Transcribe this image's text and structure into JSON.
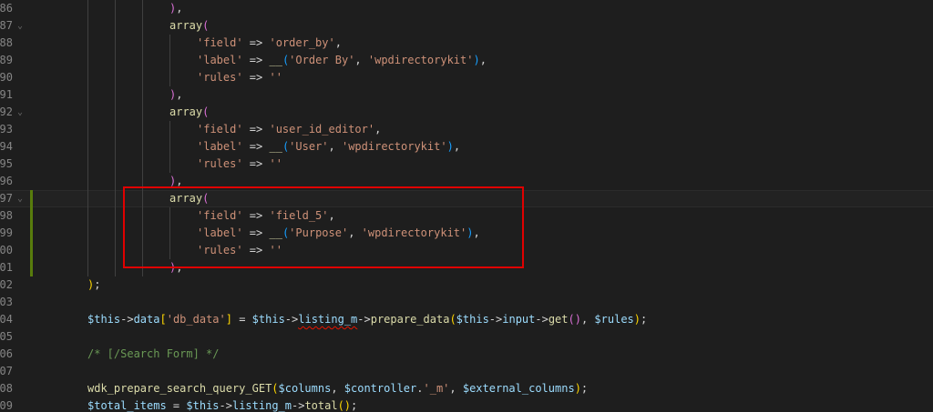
{
  "lines": [
    {
      "num": "86",
      "fold": "",
      "mod": false,
      "indent": 3,
      "tokens": [
        {
          "t": ")",
          "c": "p2"
        },
        {
          "t": ",",
          "c": "pu"
        }
      ]
    },
    {
      "num": "87",
      "fold": "⌄",
      "mod": false,
      "indent": 3,
      "tokens": [
        {
          "t": "array",
          "c": "kw"
        },
        {
          "t": "(",
          "c": "p2"
        }
      ]
    },
    {
      "num": "88",
      "fold": "",
      "mod": false,
      "indent": 4,
      "tokens": [
        {
          "t": "'field'",
          "c": "str"
        },
        {
          "t": " => ",
          "c": "op"
        },
        {
          "t": "'order_by'",
          "c": "str"
        },
        {
          "t": ",",
          "c": "pu"
        }
      ]
    },
    {
      "num": "89",
      "fold": "",
      "mod": false,
      "indent": 4,
      "tokens": [
        {
          "t": "'label'",
          "c": "str"
        },
        {
          "t": " => ",
          "c": "op"
        },
        {
          "t": "__",
          "c": "fn"
        },
        {
          "t": "(",
          "c": "p3"
        },
        {
          "t": "'Order By'",
          "c": "str"
        },
        {
          "t": ", ",
          "c": "pu"
        },
        {
          "t": "'wpdirectorykit'",
          "c": "str"
        },
        {
          "t": ")",
          "c": "p3"
        },
        {
          "t": ",",
          "c": "pu"
        }
      ]
    },
    {
      "num": "90",
      "fold": "",
      "mod": false,
      "indent": 4,
      "tokens": [
        {
          "t": "'rules'",
          "c": "str"
        },
        {
          "t": " => ",
          "c": "op"
        },
        {
          "t": "''",
          "c": "str"
        }
      ]
    },
    {
      "num": "91",
      "fold": "",
      "mod": false,
      "indent": 3,
      "tokens": [
        {
          "t": ")",
          "c": "p2"
        },
        {
          "t": ",",
          "c": "pu"
        }
      ]
    },
    {
      "num": "92",
      "fold": "⌄",
      "mod": false,
      "indent": 3,
      "tokens": [
        {
          "t": "array",
          "c": "kw"
        },
        {
          "t": "(",
          "c": "p2"
        }
      ]
    },
    {
      "num": "93",
      "fold": "",
      "mod": false,
      "indent": 4,
      "tokens": [
        {
          "t": "'field'",
          "c": "str"
        },
        {
          "t": " => ",
          "c": "op"
        },
        {
          "t": "'user_id_editor'",
          "c": "str"
        },
        {
          "t": ",",
          "c": "pu"
        }
      ]
    },
    {
      "num": "94",
      "fold": "",
      "mod": false,
      "indent": 4,
      "tokens": [
        {
          "t": "'label'",
          "c": "str"
        },
        {
          "t": " => ",
          "c": "op"
        },
        {
          "t": "__",
          "c": "fn"
        },
        {
          "t": "(",
          "c": "p3"
        },
        {
          "t": "'User'",
          "c": "str"
        },
        {
          "t": ", ",
          "c": "pu"
        },
        {
          "t": "'wpdirectorykit'",
          "c": "str"
        },
        {
          "t": ")",
          "c": "p3"
        },
        {
          "t": ",",
          "c": "pu"
        }
      ]
    },
    {
      "num": "95",
      "fold": "",
      "mod": false,
      "indent": 4,
      "tokens": [
        {
          "t": "'rules'",
          "c": "str"
        },
        {
          "t": " => ",
          "c": "op"
        },
        {
          "t": "''",
          "c": "str"
        }
      ]
    },
    {
      "num": "96",
      "fold": "",
      "mod": false,
      "indent": 3,
      "tokens": [
        {
          "t": ")",
          "c": "p2"
        },
        {
          "t": ",",
          "c": "pu"
        }
      ]
    },
    {
      "num": "97",
      "fold": "⌄",
      "mod": true,
      "current": true,
      "indent": 3,
      "tokens": [
        {
          "t": "array",
          "c": "kw"
        },
        {
          "t": "(",
          "c": "p2"
        }
      ]
    },
    {
      "num": "98",
      "fold": "",
      "mod": true,
      "indent": 4,
      "tokens": [
        {
          "t": "'field'",
          "c": "str"
        },
        {
          "t": " => ",
          "c": "op"
        },
        {
          "t": "'field_5'",
          "c": "str"
        },
        {
          "t": ",",
          "c": "pu"
        }
      ]
    },
    {
      "num": "99",
      "fold": "",
      "mod": true,
      "indent": 4,
      "tokens": [
        {
          "t": "'label'",
          "c": "str"
        },
        {
          "t": " => ",
          "c": "op"
        },
        {
          "t": "__",
          "c": "fn"
        },
        {
          "t": "(",
          "c": "p3"
        },
        {
          "t": "'Purpose'",
          "c": "str"
        },
        {
          "t": ", ",
          "c": "pu"
        },
        {
          "t": "'wpdirectorykit'",
          "c": "str"
        },
        {
          "t": ")",
          "c": "p3"
        },
        {
          "t": ",",
          "c": "pu"
        }
      ]
    },
    {
      "num": "00",
      "fold": "",
      "mod": true,
      "indent": 4,
      "tokens": [
        {
          "t": "'rules'",
          "c": "str"
        },
        {
          "t": " => ",
          "c": "op"
        },
        {
          "t": "''",
          "c": "str"
        }
      ]
    },
    {
      "num": "01",
      "fold": "",
      "mod": true,
      "indent": 3,
      "tokens": [
        {
          "t": ")",
          "c": "p2"
        },
        {
          "t": ",",
          "c": "pu"
        }
      ]
    },
    {
      "num": "02",
      "fold": "",
      "mod": false,
      "indent": 0,
      "tokens": [
        {
          "t": ")",
          "c": "p1"
        },
        {
          "t": ";",
          "c": "pu"
        }
      ]
    },
    {
      "num": "03",
      "fold": "",
      "mod": false,
      "indent": 0,
      "tokens": []
    },
    {
      "num": "04",
      "fold": "",
      "mod": false,
      "indent": 0,
      "tokens": [
        {
          "t": "$this",
          "c": "var"
        },
        {
          "t": "->",
          "c": "op"
        },
        {
          "t": "data",
          "c": "var"
        },
        {
          "t": "[",
          "c": "p1"
        },
        {
          "t": "'db_data'",
          "c": "str"
        },
        {
          "t": "]",
          "c": "p1"
        },
        {
          "t": " = ",
          "c": "op"
        },
        {
          "t": "$this",
          "c": "var"
        },
        {
          "t": "->",
          "c": "op"
        },
        {
          "t": "listing_m",
          "c": "var squig"
        },
        {
          "t": "->",
          "c": "op"
        },
        {
          "t": "prepare_data",
          "c": "fn"
        },
        {
          "t": "(",
          "c": "p1"
        },
        {
          "t": "$this",
          "c": "var"
        },
        {
          "t": "->",
          "c": "op"
        },
        {
          "t": "input",
          "c": "var"
        },
        {
          "t": "->",
          "c": "op"
        },
        {
          "t": "get",
          "c": "fn"
        },
        {
          "t": "()",
          "c": "p2"
        },
        {
          "t": ", ",
          "c": "pu"
        },
        {
          "t": "$rules",
          "c": "var"
        },
        {
          "t": ")",
          "c": "p1"
        },
        {
          "t": ";",
          "c": "pu"
        }
      ]
    },
    {
      "num": "05",
      "fold": "",
      "mod": false,
      "indent": 0,
      "tokens": []
    },
    {
      "num": "06",
      "fold": "",
      "mod": false,
      "indent": 0,
      "tokens": [
        {
          "t": "/* [/Search Form] */",
          "c": "cm"
        }
      ]
    },
    {
      "num": "07",
      "fold": "",
      "mod": false,
      "indent": 0,
      "tokens": []
    },
    {
      "num": "08",
      "fold": "",
      "mod": false,
      "indent": 0,
      "tokens": [
        {
          "t": "wdk_prepare_search_query_GET",
          "c": "fn"
        },
        {
          "t": "(",
          "c": "p1"
        },
        {
          "t": "$columns",
          "c": "var"
        },
        {
          "t": ", ",
          "c": "pu"
        },
        {
          "t": "$controller",
          "c": "var"
        },
        {
          "t": ".",
          "c": "op"
        },
        {
          "t": "'_m'",
          "c": "str"
        },
        {
          "t": ", ",
          "c": "pu"
        },
        {
          "t": "$external_columns",
          "c": "var"
        },
        {
          "t": ")",
          "c": "p1"
        },
        {
          "t": ";",
          "c": "pu"
        }
      ]
    },
    {
      "num": "09",
      "fold": "",
      "mod": false,
      "indent": 0,
      "tokens": [
        {
          "t": "$total_items",
          "c": "var"
        },
        {
          "t": " = ",
          "c": "op"
        },
        {
          "t": "$this",
          "c": "var"
        },
        {
          "t": "->",
          "c": "op"
        },
        {
          "t": "listing_m",
          "c": "var squig"
        },
        {
          "t": "->",
          "c": "op"
        },
        {
          "t": "total",
          "c": "fn"
        },
        {
          "t": "()",
          "c": "p1"
        },
        {
          "t": ";",
          "c": "pu"
        }
      ]
    },
    {
      "num": "10",
      "fold": "",
      "mod": false,
      "indent": 0,
      "tokens": []
    }
  ]
}
